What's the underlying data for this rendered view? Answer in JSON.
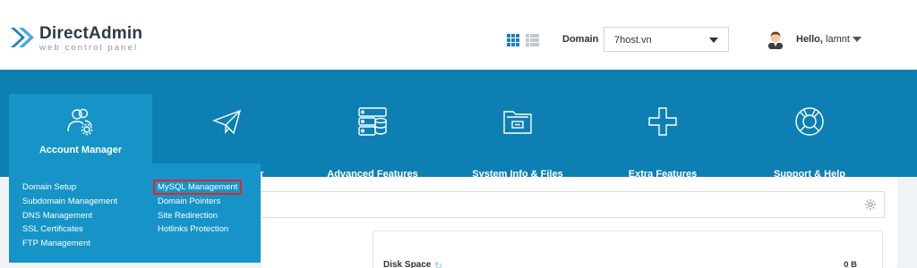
{
  "brand": {
    "title": "DirectAdmin",
    "subtitle": "web control panel",
    "color": "#1d7dbf"
  },
  "header": {
    "domain_label": "Domain",
    "domain_value": "7host.vn",
    "greeting": "Hello,",
    "username": "lamnt"
  },
  "nav": [
    {
      "label": "Account Manager",
      "icon": "users-gear-icon",
      "active": true
    },
    {
      "label": "E-mail Manager",
      "icon": "paper-plane-icon"
    },
    {
      "label": "Advanced Features",
      "icon": "server-database-icon"
    },
    {
      "label": "System Info & Files",
      "icon": "folder-icon"
    },
    {
      "label": "Extra Features",
      "icon": "plus-icon"
    },
    {
      "label": "Support & Help",
      "icon": "lifebuoy-icon"
    }
  ],
  "menu": {
    "col1": [
      "Domain Setup",
      "Subdomain Management",
      "DNS Management",
      "SSL Certificates",
      "FTP Management"
    ],
    "col2": [
      "MySQL Management",
      "Domain Pointers",
      "Site Redirection",
      "Hotlinks Protection"
    ]
  },
  "stats": {
    "disk_label": "Disk Space",
    "disk_value": "0 B"
  },
  "colors": {
    "nav_bg": "#0d7fb2",
    "active_bg": "#1694c8",
    "highlight": "#e0262b"
  }
}
